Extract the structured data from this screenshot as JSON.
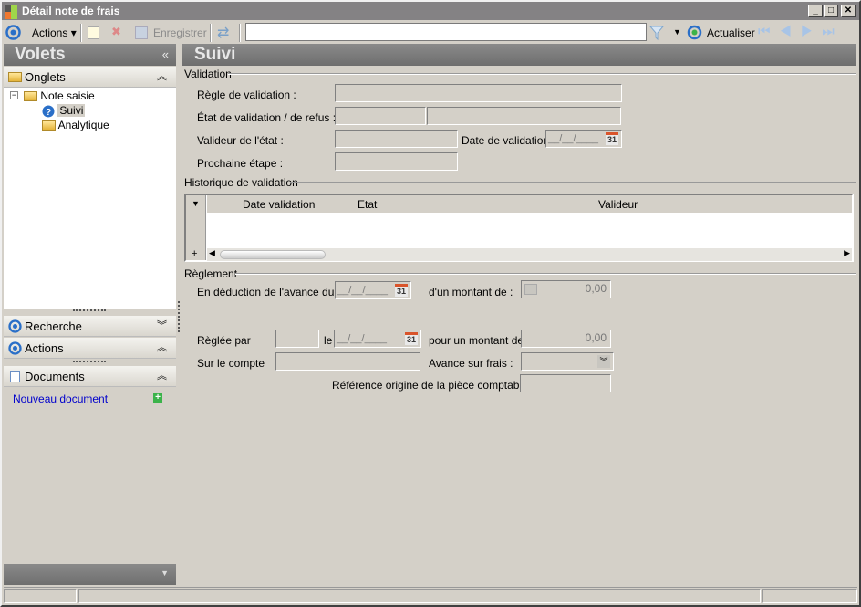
{
  "window": {
    "title": "Détail note de frais",
    "minimize": "_",
    "maximize": "□",
    "close": "✕"
  },
  "toolbar": {
    "actions": "Actions",
    "save": "Enregistrer",
    "refresh": "Actualiser",
    "search_value": ""
  },
  "left": {
    "header": "Volets",
    "collapse": "«",
    "onglets": "Onglets",
    "tree": [
      {
        "label": "Note saisie"
      },
      {
        "label": "Suivi"
      },
      {
        "label": "Analytique"
      }
    ],
    "recherche": "Recherche",
    "actions": "Actions",
    "documents": "Documents",
    "new_document": "Nouveau document"
  },
  "main": {
    "header": "Suivi",
    "validation": {
      "title": "Validation",
      "rule": "Règle de validation :",
      "state": "État de validation / de refus :",
      "validator": "Valideur de l'état :",
      "date": "Date de validation :",
      "date_value": "__/__/____",
      "next": "Prochaine étape :"
    },
    "history": {
      "title": "Historique de validation",
      "columns": [
        "Date validation",
        "Etat",
        "Valideur"
      ]
    },
    "reglement": {
      "title": "Règlement",
      "deduction": "En déduction de l'avance du",
      "deduction_date": "__/__/____",
      "amount_label": "d'un montant de  :",
      "amount": "0,00",
      "paid_by": "Règlée par",
      "on": "le",
      "paid_date": "__/__/____",
      "paid_amount_label": "pour un montant de",
      "paid_amount": "0,00",
      "account": "Sur le compte",
      "advance": "Avance sur frais :",
      "reference": "Référence origine de la pièce comptable :"
    }
  }
}
